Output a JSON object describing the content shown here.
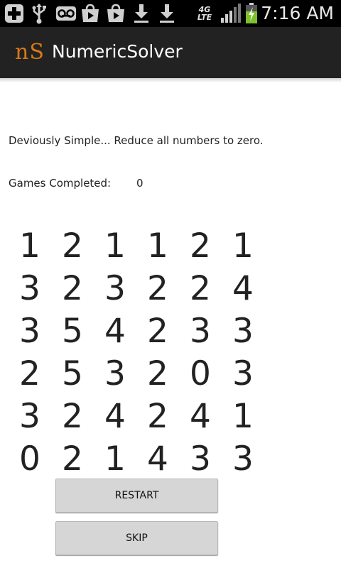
{
  "status_bar": {
    "time": "7:16 AM",
    "network": "4G LTE",
    "icons": [
      "plus-icon",
      "usb-icon",
      "voicemail-icon",
      "play-store-icon",
      "play-store-icon",
      "download-icon",
      "download-icon",
      "signal-icon",
      "battery-charging-icon"
    ]
  },
  "action_bar": {
    "logo": "nS",
    "title": "NumericSolver"
  },
  "main": {
    "instructions": "Deviously Simple... Reduce all numbers to zero.",
    "games_completed_label": "Games Completed:",
    "games_completed_value": "0",
    "grid": [
      [
        "1",
        "2",
        "1",
        "1",
        "2",
        "1"
      ],
      [
        "3",
        "2",
        "3",
        "2",
        "2",
        "4"
      ],
      [
        "3",
        "5",
        "4",
        "2",
        "3",
        "3"
      ],
      [
        "2",
        "5",
        "3",
        "2",
        "0",
        "3"
      ],
      [
        "3",
        "2",
        "4",
        "2",
        "4",
        "1"
      ],
      [
        "0",
        "2",
        "1",
        "4",
        "3",
        "3"
      ]
    ],
    "restart_label": "RESTART",
    "skip_label": "SKIP"
  },
  "colors": {
    "action_bar": "#222222",
    "logo": "#d67a17",
    "button": "#d6d6d6"
  }
}
